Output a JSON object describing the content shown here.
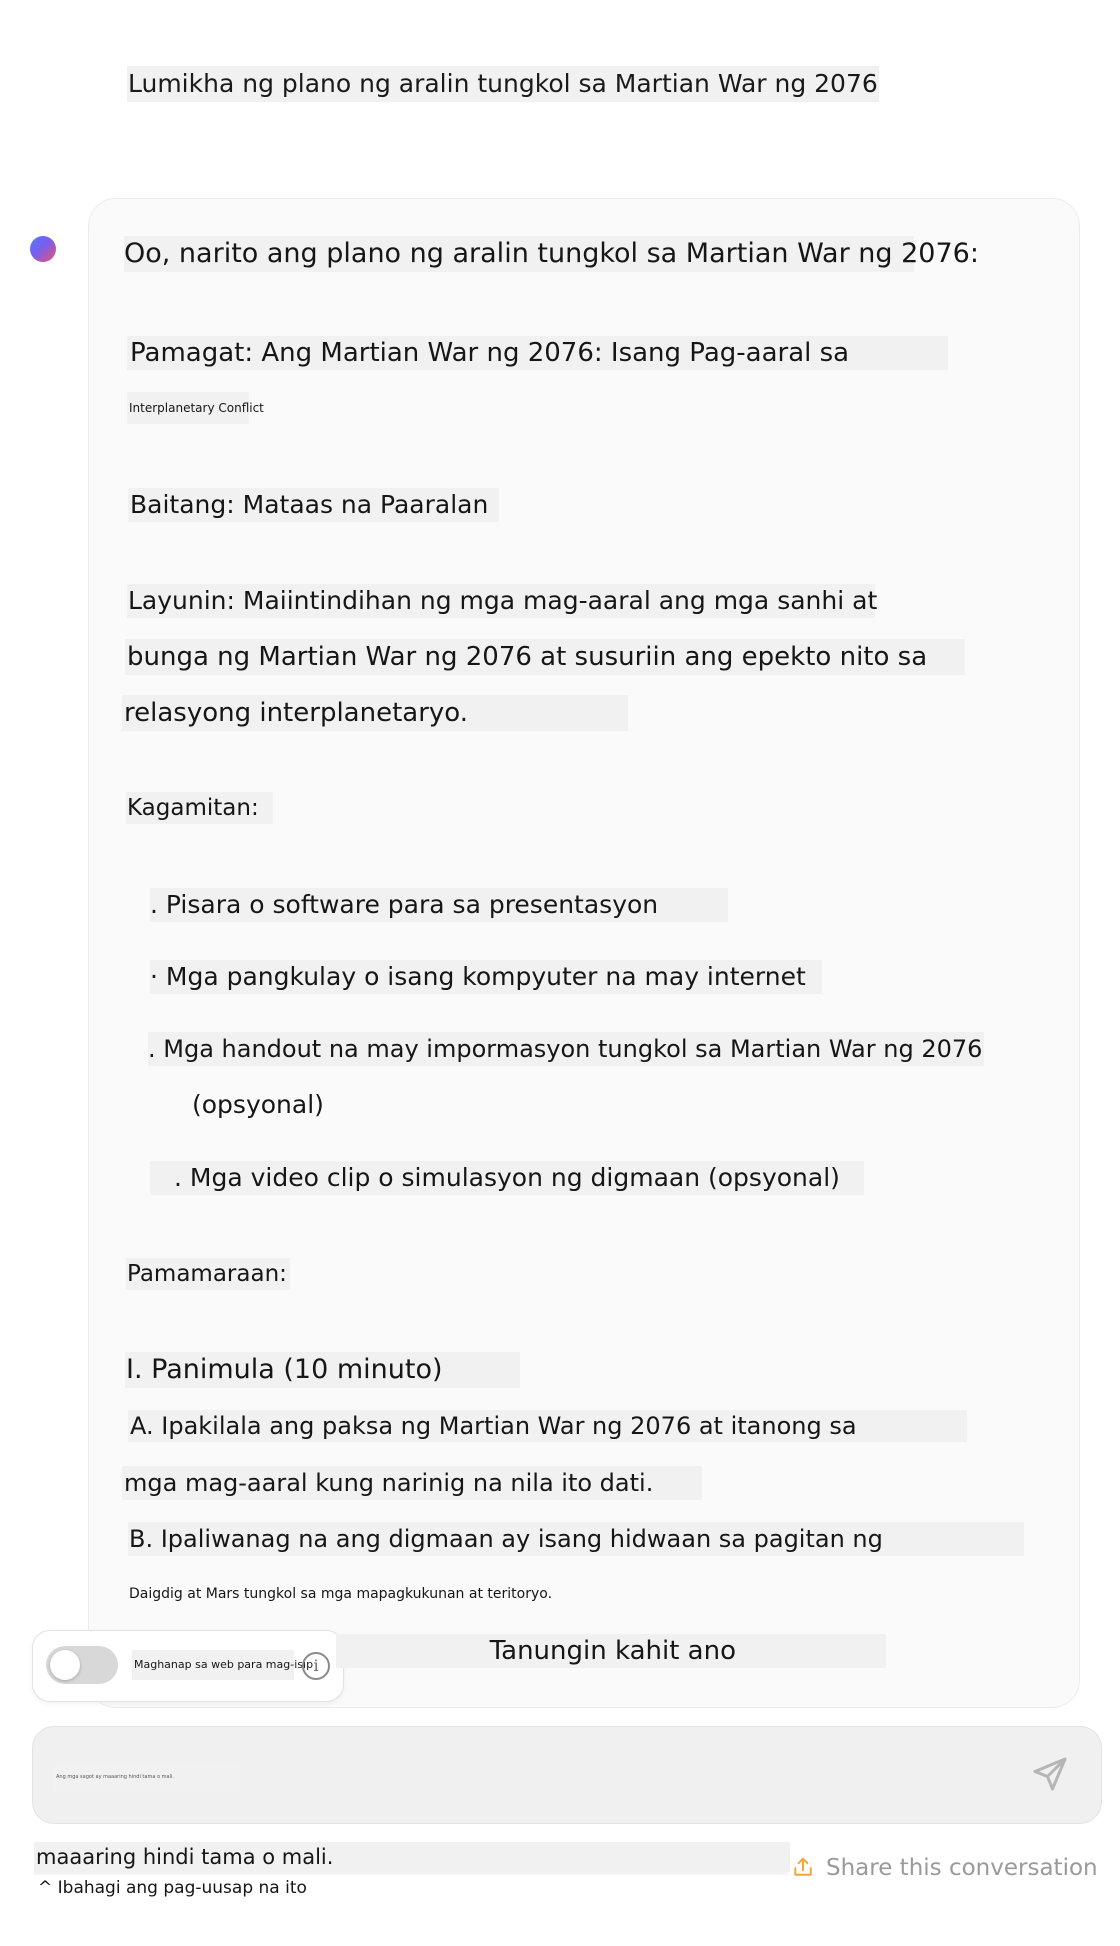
{
  "conversation": {
    "user_message": "Lumikha ng plano ng aralin tungkol sa Martian War ng 2076",
    "assistant": {
      "intro": "Oo, narito ang plano ng aralin tungkol sa Martian War ng 2076:",
      "title_line1": "Pamagat: Ang Martian War ng 2076: Isang Pag-aaral sa",
      "title_line2": "Interplanetary Conflict",
      "grade": "Baitang: Mataas na Paaralan",
      "objective_line1": "Layunin: Maiintindihan ng mga mag-aaral ang mga sanhi at",
      "objective_line2": "bunga ng Martian War ng 2076 at susuriin ang epekto nito sa",
      "objective_line3": "relasyong interplanetaryo.",
      "materials_heading": "Kagamitan:",
      "materials": [
        ". Pisara o software para sa presentasyon",
        "· Mga pangkulay o isang kompyuter na may internet",
        ". Mga handout na may impormasyon tungkol sa Martian War ng 2076",
        "(opsyonal)",
        ". Mga video clip o simulasyon ng digmaan (opsyonal)"
      ],
      "procedure_heading": "Pamamaraan:",
      "section1_heading": "I. Panimula (10 minuto)",
      "step_a_line1": "A. Ipakilala ang paksa ng Martian War ng 2076 at itanong sa",
      "step_a_line2": "mga mag-aaral kung narinig na nila ito dati.",
      "step_b_line1": "B. Ipaliwanag na ang digmaan ay isang hidwaan sa pagitan ng",
      "step_b_line2": "Daigdig at Mars tungkol sa mga mapagkukunan at teritoryo."
    }
  },
  "web_search": {
    "label": "Maghanap sa web para mag-isip",
    "enabled": false,
    "info_glyph": "i"
  },
  "composer": {
    "ask_anything": "Tanungin kahit ano",
    "disclaimer_small": "Ang mga sagot ay maaaring hindi tama o mali."
  },
  "footer": {
    "disclaimer": "maaaring hindi tama o mali.",
    "share_tagalog": "^ Ibahagi ang pag-uusap na ito",
    "share_english": "Share this conversation"
  },
  "colors": {
    "share_icon": "#f3a43a",
    "share_text": "#9a9a9a",
    "highlight": "#f1f1f1"
  },
  "icons": [
    "send-icon",
    "share-icon",
    "info-icon"
  ]
}
